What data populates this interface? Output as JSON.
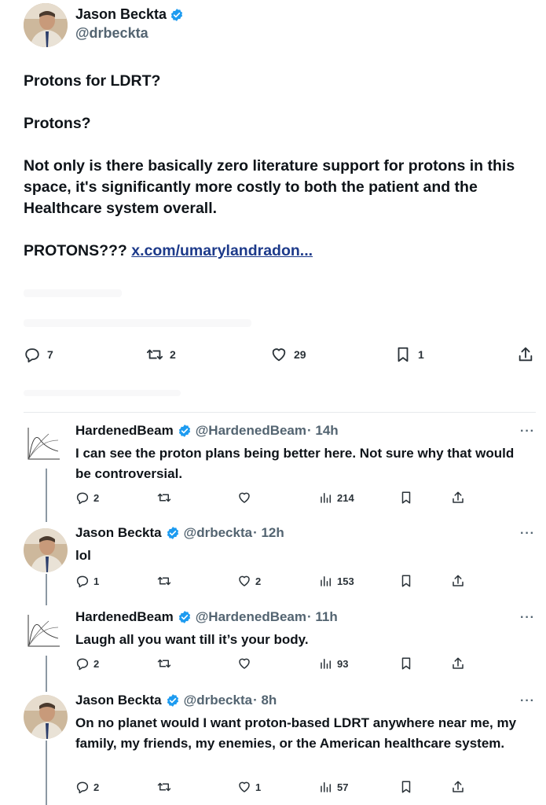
{
  "main_tweet": {
    "author_name": "Jason Beckta",
    "author_handle": "@drbeckta",
    "paragraphs": [
      "Protons for LDRT?",
      "Protons?",
      "Not only is there basically zero literature support for protons in this space, it's significantly more costly to both the patient and the Healthcare system overall."
    ],
    "last_line_prefix": "PROTONS??? ",
    "link_text": "x.com/umarylandradon...",
    "stats": {
      "replies": "7",
      "retweets": "2",
      "likes": "29",
      "bookmarks": "1"
    }
  },
  "replies": [
    {
      "name": "HardenedBeam",
      "handle": "@HardenedBeam",
      "time": "14h",
      "text": "I can see the proton plans being better here. Not sure why that would be controversial.",
      "replies": "2",
      "likes": "",
      "views": "214",
      "avatar": "chart"
    },
    {
      "name": "Jason Beckta",
      "handle": "@drbeckta",
      "time": "12h",
      "text": "lol",
      "replies": "1",
      "likes": "2",
      "views": "153",
      "avatar": "photo"
    },
    {
      "name": "HardenedBeam",
      "handle": "@HardenedBeam",
      "time": "11h",
      "text": "Laugh all you want till it’s your body.",
      "replies": "2",
      "likes": "",
      "views": "93",
      "avatar": "chart"
    },
    {
      "name": "Jason Beckta",
      "handle": "@drbeckta",
      "time": "8h",
      "text": "On no planet would I want proton-based LDRT anywhere near me, my family, my friends, my enemies, or the American healthcare system.",
      "replies": "2",
      "likes": "1",
      "views": "57",
      "avatar": "photo"
    }
  ],
  "ui": {
    "separator": "·",
    "more_label": "···",
    "colors": {
      "verified": "#1d9bf0",
      "link": "#1d3a8a",
      "muted": "#536471",
      "text": "#0f1419"
    },
    "icons": [
      "reply-icon",
      "retweet-icon",
      "like-icon",
      "bookmark-icon",
      "share-icon",
      "views-icon",
      "verified-icon"
    ]
  }
}
